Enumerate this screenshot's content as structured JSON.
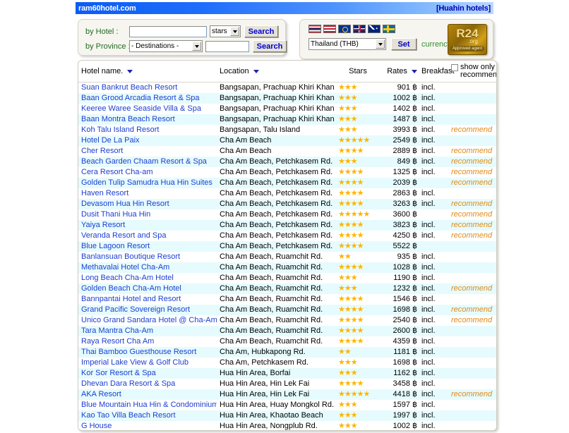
{
  "header": {
    "site": "ram60hotel.com",
    "location_link": "[Huahin hotels]"
  },
  "search": {
    "by_hotel_label": "by Hotel :",
    "hotel_input_value": "",
    "stars_select": "stars",
    "search_button_1": "Search",
    "by_province_label": "by Province :",
    "province_select": "- Destinations -",
    "province_input_value": "",
    "search_button_2": "Search"
  },
  "currency": {
    "select": "Thailand (THB)",
    "set_button": "Set",
    "word": "currency",
    "flags": [
      "Thailand",
      "United States",
      "European Union",
      "United Kingdom",
      "Australia",
      "Sweden"
    ],
    "badge_title": "R24",
    "badge_org": ".org",
    "badge_sub": "Approved agent"
  },
  "table": {
    "headers": {
      "hotel": "Hotel name.",
      "location": "Location",
      "stars": "Stars",
      "rates": "Rates",
      "breakfast": "Breakfast",
      "showonly_1": "show only",
      "showonly_2": "recommended"
    },
    "rows": [
      {
        "name": "Suan Bankrut Beach Resort",
        "location": "Bangsapan, Prachuap Khiri Khan",
        "stars": 2.5,
        "rate": "901 ฿",
        "breakfast": "incl.",
        "rec": ""
      },
      {
        "name": "Baan Grood Arcadia Resort & Spa",
        "location": "Bangsapan, Prachuap Khiri Khan",
        "stars": 2.5,
        "rate": "1002 ฿",
        "breakfast": "incl.",
        "rec": ""
      },
      {
        "name": "Keeree Waree Seaside Villa & Spa",
        "location": "Bangsapan, Prachuap Khiri Khan",
        "stars": 3,
        "rate": "1402 ฿",
        "breakfast": "incl.",
        "rec": ""
      },
      {
        "name": "Baan Montra Beach Resort",
        "location": "Bangsapan, Prachuap Khiri Khan",
        "stars": 3,
        "rate": "1487 ฿",
        "breakfast": "incl.",
        "rec": ""
      },
      {
        "name": "Koh Talu Island Resort",
        "location": "Bangsapan, Talu Island",
        "stars": 3,
        "rate": "3993 ฿",
        "breakfast": "incl.",
        "rec": "recommend"
      },
      {
        "name": "Hotel De La Paix",
        "location": "Cha Am Beach",
        "stars": 5,
        "rate": "2549 ฿",
        "breakfast": "incl.",
        "rec": ""
      },
      {
        "name": "Cher Resort",
        "location": "Cha Am Beach",
        "stars": 4,
        "rate": "2889 ฿",
        "breakfast": "incl.",
        "rec": "recommend"
      },
      {
        "name": "Beach Garden Chaam Resort & Spa",
        "location": "Cha Am Beach, Petchkasem Rd.",
        "stars": 3,
        "rate": "849 ฿",
        "breakfast": "incl.",
        "rec": "recommend"
      },
      {
        "name": "Cera Resort Cha-am",
        "location": "Cha Am Beach, Petchkasem Rd.",
        "stars": 3.5,
        "rate": "1325 ฿",
        "breakfast": "incl.",
        "rec": "recommend"
      },
      {
        "name": "Golden Tulip Samudra Hua Hin Suites",
        "location": "Cha Am Beach, Petchkasem Rd.",
        "stars": 4,
        "rate": "2039 ฿",
        "breakfast": "",
        "rec": "recommend"
      },
      {
        "name": "Haven Resort",
        "location": "Cha Am Beach, Petchkasem Rd.",
        "stars": 4,
        "rate": "2863 ฿",
        "breakfast": "incl.",
        "rec": ""
      },
      {
        "name": "Devasom Hua Hin Resort",
        "location": "Cha Am Beach, Petchkasem Rd.",
        "stars": 4,
        "rate": "3263 ฿",
        "breakfast": "incl.",
        "rec": "recommend"
      },
      {
        "name": "Dusit Thani Hua Hin",
        "location": "Cha Am Beach, Petchkasem Rd.",
        "stars": 5,
        "rate": "3600 ฿",
        "breakfast": "",
        "rec": "recommend"
      },
      {
        "name": "Yaiya Resort",
        "location": "Cha Am Beach, Petchkasem Rd.",
        "stars": 4,
        "rate": "3823 ฿",
        "breakfast": "incl.",
        "rec": "recommend"
      },
      {
        "name": "Veranda Resort and Spa",
        "location": "Cha Am Beach, Petchkasem Rd.",
        "stars": 4,
        "rate": "4250 ฿",
        "breakfast": "incl.",
        "rec": "recommend"
      },
      {
        "name": "Blue Lagoon Resort",
        "location": "Cha Am Beach, Petchkasem Rd.",
        "stars": 3.5,
        "rate": "5522 ฿",
        "breakfast": "",
        "rec": ""
      },
      {
        "name": "Banlansuan Boutique Resort",
        "location": "Cha Am Beach, Ruamchit Rd.",
        "stars": 2,
        "rate": "935 ฿",
        "breakfast": "incl.",
        "rec": ""
      },
      {
        "name": "Methavalai Hotel Cha-Am",
        "location": "Cha Am Beach, Ruamchit Rd.",
        "stars": 3.5,
        "rate": "1028 ฿",
        "breakfast": "incl.",
        "rec": ""
      },
      {
        "name": "Long Beach Cha-Am Hotel",
        "location": "Cha Am Beach, Ruamchit Rd.",
        "stars": 3,
        "rate": "1190 ฿",
        "breakfast": "incl.",
        "rec": ""
      },
      {
        "name": "Golden Beach Cha-Am Hotel",
        "location": "Cha Am Beach, Ruamchit Rd.",
        "stars": 2.5,
        "rate": "1232 ฿",
        "breakfast": "incl.",
        "rec": "recommend"
      },
      {
        "name": "Bannpantai Hotel and Resort",
        "location": "Cha Am Beach, Ruamchit Rd.",
        "stars": 3.5,
        "rate": "1546 ฿",
        "breakfast": "incl.",
        "rec": ""
      },
      {
        "name": "Grand Pacific Sovereign Resort",
        "location": "Cha Am Beach, Ruamchit Rd.",
        "stars": 3.5,
        "rate": "1698 ฿",
        "breakfast": "incl.",
        "rec": "recommend"
      },
      {
        "name": "Unico Grand Sandara Hotel @ Cha-Am",
        "location": "Cha Am Beach, Ruamchit Rd.",
        "stars": 3.5,
        "rate": "2540 ฿",
        "breakfast": "incl.",
        "rec": "recommend"
      },
      {
        "name": "Tara Mantra Cha-Am",
        "location": "Cha Am Beach, Ruamchit Rd.",
        "stars": 4,
        "rate": "2600 ฿",
        "breakfast": "incl.",
        "rec": ""
      },
      {
        "name": "Raya Resort Cha Am",
        "location": "Cha Am Beach, Ruamchit Rd.",
        "stars": 4,
        "rate": "4359 ฿",
        "breakfast": "incl.",
        "rec": ""
      },
      {
        "name": "Thai Bamboo Guesthouse Resort",
        "location": "Cha Am, Hubkapong Rd.",
        "stars": 2,
        "rate": "1181 ฿",
        "breakfast": "incl.",
        "rec": ""
      },
      {
        "name": "Imperial Lake View & Golf Club",
        "location": "Cha Am, Petchkasem Rd.",
        "stars": 3,
        "rate": "1698 ฿",
        "breakfast": "incl.",
        "rec": ""
      },
      {
        "name": "Kor Sor Resort & Spa",
        "location": "Hua Hin Area, Borfai",
        "stars": 3,
        "rate": "1162 ฿",
        "breakfast": "incl.",
        "rec": ""
      },
      {
        "name": "Dhevan Dara Resort & Spa",
        "location": "Hua Hin Area, Hin Lek Fai",
        "stars": 4,
        "rate": "3458 ฿",
        "breakfast": "incl.",
        "rec": ""
      },
      {
        "name": "AKA Resort",
        "location": "Hua Hin Area, Hin Lek Fai",
        "stars": 5,
        "rate": "4418 ฿",
        "breakfast": "incl.",
        "rec": "recommend"
      },
      {
        "name": "Blue Mountain Hua Hin & Condominium",
        "location": "Hua Hin Area, Huay Mongkol Rd.",
        "stars": 3,
        "rate": "1597 ฿",
        "breakfast": "incl.",
        "rec": ""
      },
      {
        "name": "Kao Tao Villa Beach Resort",
        "location": "Hua Hin Area, Khaotao Beach",
        "stars": 2.5,
        "rate": "1997 ฿",
        "breakfast": "incl.",
        "rec": ""
      },
      {
        "name": "G House",
        "location": "Hua Hin Area, Nongplub Rd.",
        "stars": 2.5,
        "rate": "1002 ฿",
        "breakfast": "incl.",
        "rec": ""
      }
    ]
  },
  "colors": {
    "title_bar_start": "#0a5cf5",
    "link_blue": "#1a3fd0",
    "recommend_orange": "#e08a18",
    "star_gold": "#ffb400",
    "row_alt": "#e6fbfd",
    "panel_bg": "#f7f5ef",
    "label_green": "#1f6b1f"
  }
}
